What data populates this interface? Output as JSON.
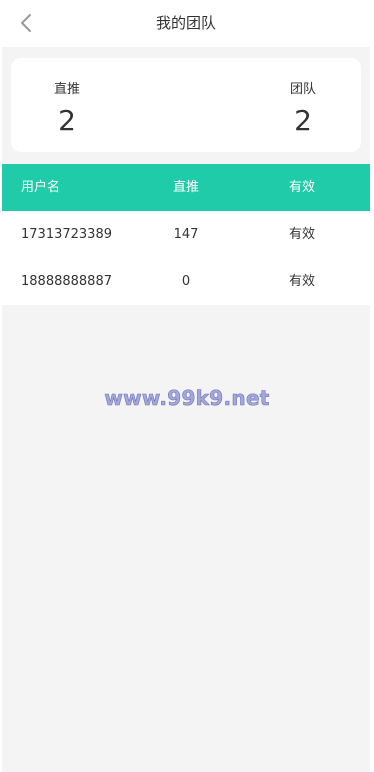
{
  "header": {
    "title": "我的团队",
    "back_icon": "chevron-left-icon"
  },
  "summary": {
    "direct_label": "直推",
    "direct_value": "2",
    "team_label": "团队",
    "team_value": "2"
  },
  "table": {
    "columns": [
      "用户名",
      "直推",
      "有效"
    ],
    "rows": [
      {
        "username": "17313723389",
        "direct": "147",
        "status": "有效"
      },
      {
        "username": "18888888887",
        "direct": "0",
        "status": "有效"
      }
    ]
  },
  "watermark": "www.99k9.net",
  "colors": {
    "accent": "#20cba9",
    "background": "#f4f4f4",
    "card": "#ffffff",
    "text": "#333333",
    "watermark": "#a3a7da"
  }
}
